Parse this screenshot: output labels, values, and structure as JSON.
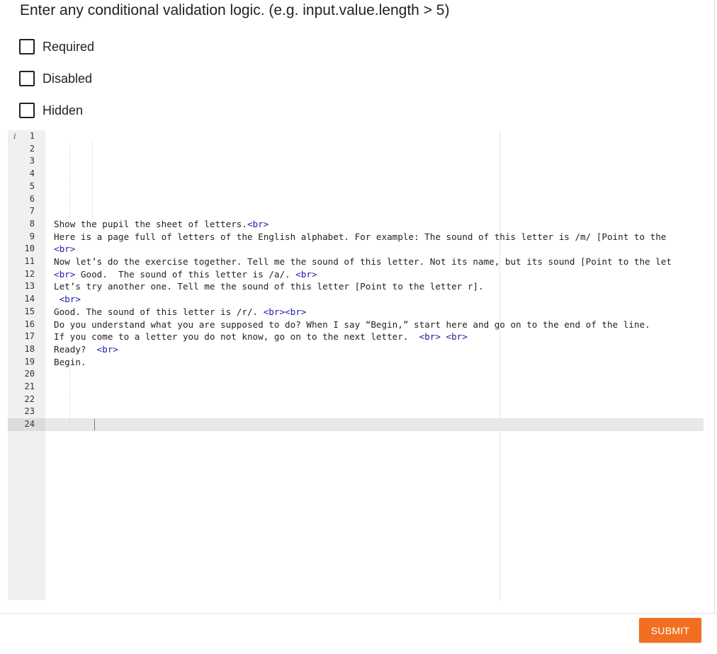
{
  "validation": {
    "hint": "Enter any conditional validation logic. (e.g. input.value.length > 5)"
  },
  "options": [
    {
      "label": "Required",
      "checked": false
    },
    {
      "label": "Disabled",
      "checked": false
    },
    {
      "label": "Hidden",
      "checked": false
    }
  ],
  "editor": {
    "info_icon_glyph": "i",
    "active_line": 24,
    "lines": [
      [],
      [],
      [],
      [],
      [],
      [],
      [],
      [
        {
          "t": "Show the pupil the sheet of letters."
        },
        {
          "t": "<br>",
          "tag": true
        }
      ],
      [
        {
          "t": "Here is a page full of letters of the English alphabet. For example: The sound of this letter is /m/ [Point to the "
        }
      ],
      [
        {
          "t": "<br>",
          "tag": true
        }
      ],
      [
        {
          "t": "Now let’s do the exercise together. Tell me the sound of this letter. Not its name, but its sound [Point to the let"
        }
      ],
      [
        {
          "t": "<br>",
          "tag": true
        },
        {
          "t": " Good.  The sound of this letter is /a/. "
        },
        {
          "t": "<br>",
          "tag": true
        }
      ],
      [
        {
          "t": "Let’s try another one. Tell me the sound of this letter [Point to the letter r]."
        }
      ],
      [
        {
          "t": " "
        },
        {
          "t": "<br>",
          "tag": true
        }
      ],
      [
        {
          "t": "Good. The sound of this letter is /r/. "
        },
        {
          "t": "<br><br>",
          "tag": true
        }
      ],
      [
        {
          "t": "Do you understand what you are supposed to do? When I say “Begin,” start here and go on to the end of the line."
        }
      ],
      [
        {
          "t": "If you come to a letter you do not know, go on to the next letter.  "
        },
        {
          "t": "<br> <br>",
          "tag": true
        }
      ],
      [
        {
          "t": "Ready?  "
        },
        {
          "t": "<br>",
          "tag": true
        }
      ],
      [
        {
          "t": "Begin."
        }
      ],
      [],
      [],
      [],
      [],
      []
    ]
  },
  "footer": {
    "submit_label": "SUBMIT"
  },
  "colors": {
    "accent": "#f26f21",
    "tag": "#1a1aa6",
    "gutter": "#f0f0f0",
    "active_line": "#e8e8e8"
  }
}
